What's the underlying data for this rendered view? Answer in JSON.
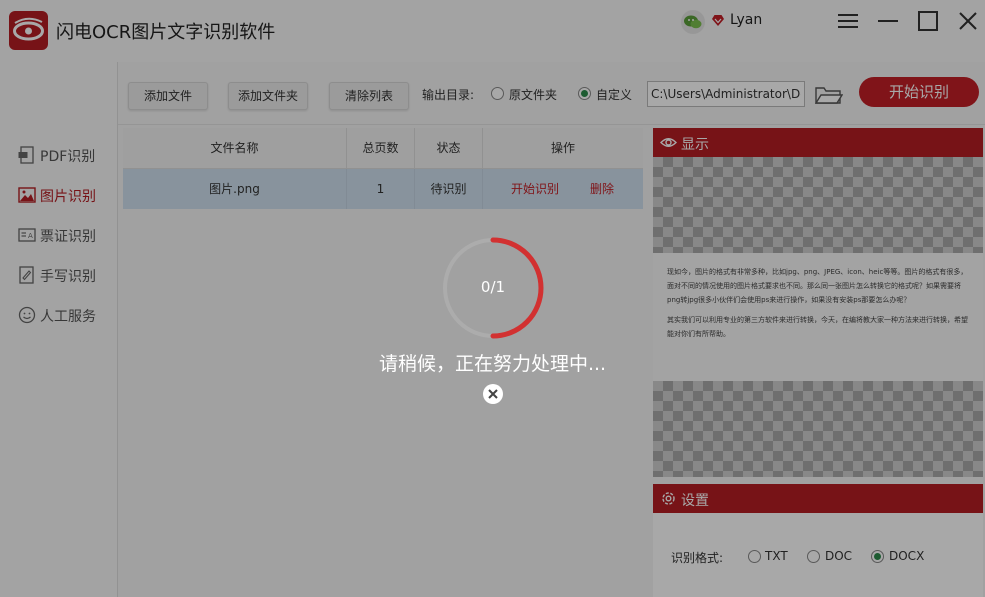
{
  "app": {
    "title": "闪电OCR图片文字识别软件"
  },
  "user": {
    "name": "Lyan"
  },
  "colors": {
    "brand": "#b51e24",
    "accent_green": "#2c8a4b",
    "selected_row": "#cfe0ee"
  },
  "sidebar": {
    "items": [
      {
        "label": "PDF识别",
        "icon": "pdf-icon",
        "active": false
      },
      {
        "label": "图片识别",
        "icon": "image-icon",
        "active": true
      },
      {
        "label": "票证识别",
        "icon": "ticket-icon",
        "active": false
      },
      {
        "label": "手写识别",
        "icon": "handwriting-icon",
        "active": false
      },
      {
        "label": "人工服务",
        "icon": "service-icon",
        "active": false
      }
    ]
  },
  "toolbar": {
    "add_file": "添加文件",
    "add_folder": "添加文件夹",
    "clear_list": "清除列表",
    "output_label": "输出目录:",
    "opt_original": "原文件夹",
    "opt_custom": "自定义",
    "selected_output": "自定义",
    "path_value": "C:\\Users\\Administrator\\De",
    "start": "开始识别"
  },
  "table": {
    "headers": [
      "文件名称",
      "总页数",
      "状态",
      "操作"
    ],
    "rows": [
      {
        "name": "图片.png",
        "pages": "1",
        "status": "待识别",
        "op_start": "开始识别",
        "op_delete": "删除"
      }
    ]
  },
  "preview": {
    "title": "显示",
    "paragraphs": [
      "现如今，图片的格式有非常多种，比如jpg、png、JPEG、icon、heic等等。图片的格式有很多，面对不同的情况使用的图片格式要求也不同。那么同一张图片怎么转换它的格式呢？如果需要将png转jpg很多小伙伴们会使用ps来进行操作，如果没有安装ps那要怎么办呢？",
      "其实我们可以利用专业的第三方软件来进行转换，今天，在编将教大家一种方法来进行转换，希望能对你们有所帮助。"
    ]
  },
  "settings": {
    "title": "设置",
    "format_label": "识别格式:",
    "formats": [
      "TXT",
      "DOC",
      "DOCX"
    ],
    "selected_format": "DOCX"
  },
  "modal": {
    "progress": "0/1",
    "message": "请稍候，正在努力处理中..."
  }
}
